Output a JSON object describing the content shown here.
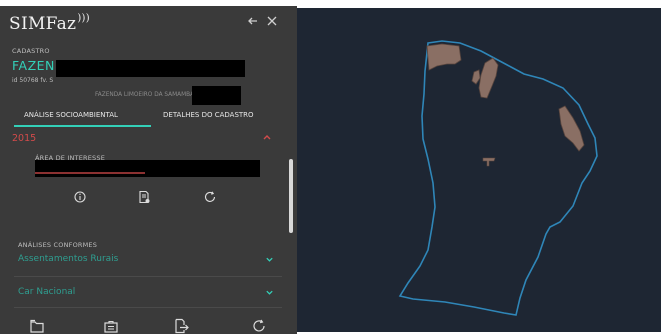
{
  "app": {
    "logo_text": "SIMFaz"
  },
  "panel": {
    "cadastro_label": "CADASTRO",
    "title": "FAZEND",
    "id_line": "id 50768 fv. S",
    "subtitle": "FAZENDA LIMOEIRO DA SAMAMBAIA",
    "tabs": [
      {
        "label": "ANÁLISE SOCIOAMBIENTAL",
        "active": true
      },
      {
        "label": "DETALHES DO CADASTRO",
        "active": false
      }
    ],
    "section": {
      "year": "2015",
      "area_label": "ÁREA DE INTERESSE"
    },
    "analises_label": "ANÁLISES CONFORMES",
    "menu_items": [
      {
        "label": "Assentamentos Rurais"
      },
      {
        "label": "Car Nacional"
      }
    ]
  },
  "icons": {
    "back": "arrow-left-icon",
    "close": "close-icon",
    "section": [
      "info-icon",
      "document-icon",
      "refresh-icon"
    ],
    "footer": [
      "folder-icon",
      "briefcase-icon",
      "export-icon",
      "refresh-icon"
    ]
  },
  "colors": {
    "panel_bg": "#3a3a3a",
    "accent": "#33d0b8",
    "alert_red": "#d24b4b",
    "map_bg": "#1e2633",
    "boundary": "#2f86b8",
    "feature": "#8a6f64"
  }
}
